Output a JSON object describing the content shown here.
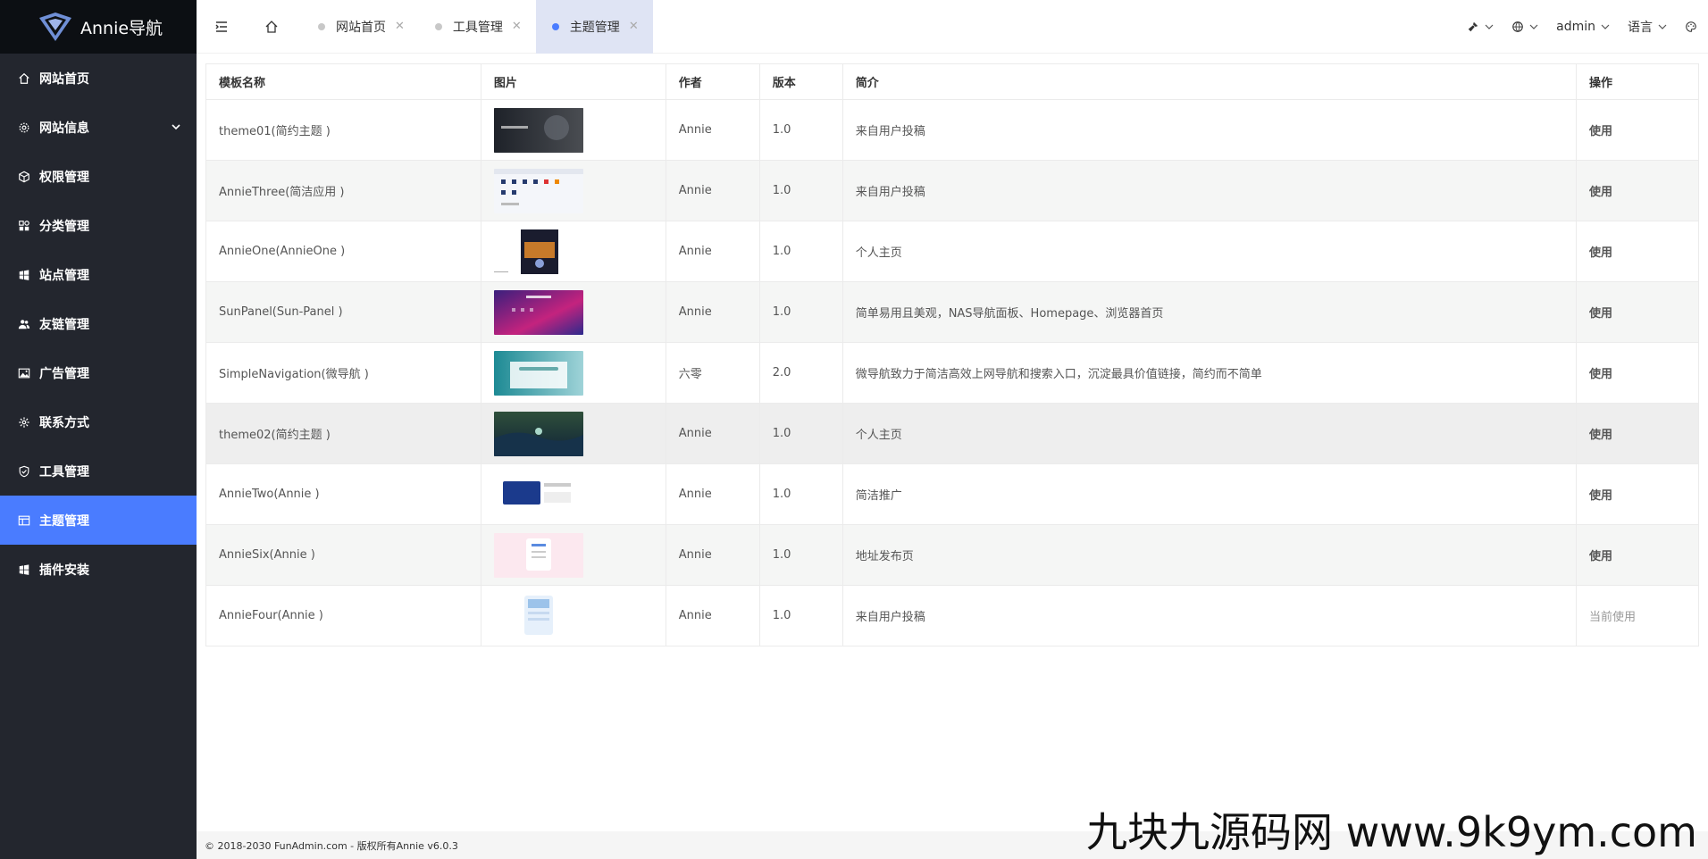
{
  "app": {
    "name": "Annie导航"
  },
  "sidebar": {
    "items": [
      {
        "label": "网站首页",
        "icon": "home-icon",
        "active": false
      },
      {
        "label": "网站信息",
        "icon": "gear-icon",
        "active": false,
        "expandable": true
      },
      {
        "label": "权限管理",
        "icon": "cube-icon",
        "active": false
      },
      {
        "label": "分类管理",
        "icon": "apps-icon",
        "active": false
      },
      {
        "label": "站点管理",
        "icon": "windows-icon",
        "active": false
      },
      {
        "label": "友链管理",
        "icon": "users-icon",
        "active": false
      },
      {
        "label": "广告管理",
        "icon": "image-icon",
        "active": false
      },
      {
        "label": "联系方式",
        "icon": "cog-icon",
        "active": false
      },
      {
        "label": "工具管理",
        "icon": "shield-check-icon",
        "active": false
      },
      {
        "label": "主题管理",
        "icon": "layout-icon",
        "active": true
      },
      {
        "label": "插件安装",
        "icon": "windows-icon",
        "active": false
      }
    ]
  },
  "topbar": {
    "tabs": [
      {
        "label": "网站首页",
        "active": false
      },
      {
        "label": "工具管理",
        "active": false
      },
      {
        "label": "主题管理",
        "active": true
      }
    ],
    "close_glyph": "✕",
    "right": {
      "user": "admin",
      "language": "语言"
    }
  },
  "table": {
    "headers": [
      "模板名称",
      "图片",
      "作者",
      "版本",
      "简介",
      "操作"
    ],
    "rows": [
      {
        "name": "theme01(简约主题 )",
        "author": "Annie",
        "version": "1.0",
        "desc": "来自用户投稿",
        "op": "使用",
        "thumb": "dark-game"
      },
      {
        "name": "AnnieThree(简洁应用 )",
        "author": "Annie",
        "version": "1.0",
        "desc": "来自用户投稿",
        "op": "使用",
        "thumb": "light-grid"
      },
      {
        "name": "AnnieOne(AnnieOne )",
        "author": "Annie",
        "version": "1.0",
        "desc": "个人主页",
        "op": "使用",
        "thumb": "dark-portrait"
      },
      {
        "name": "SunPanel(Sun-Panel )",
        "author": "Annie",
        "version": "1.0",
        "desc": "简单易用且美观，NAS导航面板、Homepage、浏览器首页",
        "op": "使用",
        "thumb": "purple-pink"
      },
      {
        "name": "SimpleNavigation(微导航 )",
        "author": "六零",
        "version": "2.0",
        "desc": "微导航致力于简洁高效上网导航和搜索入口，沉淀最具价值链接，简约而不简单",
        "op": "使用",
        "thumb": "teal-panel"
      },
      {
        "name": "theme02(简约主题 )",
        "author": "Annie",
        "version": "1.0",
        "desc": "个人主页",
        "op": "使用",
        "thumb": "dark-landscape"
      },
      {
        "name": "AnnieTwo(Annie )",
        "author": "Annie",
        "version": "1.0",
        "desc": "简洁推广",
        "op": "使用",
        "thumb": "blue-card"
      },
      {
        "name": "AnnieSix(Annie )",
        "author": "Annie",
        "version": "1.0",
        "desc": "地址发布页",
        "op": "使用",
        "thumb": "pink-card"
      },
      {
        "name": "AnnieFour(Annie )",
        "author": "Annie",
        "version": "1.0",
        "desc": "来自用户投稿",
        "op": "当前使用",
        "thumb": "light-blue-card"
      }
    ]
  },
  "footer": {
    "text": "© 2018-2030 FunAdmin.com - 版权所有Annie v6.0.3"
  },
  "watermark": "九块九源码网 www.9k9ym.com",
  "colors": {
    "accent": "#4a7cff",
    "sidebar_bg": "#23262e",
    "logo_bg": "#0c0f13"
  }
}
